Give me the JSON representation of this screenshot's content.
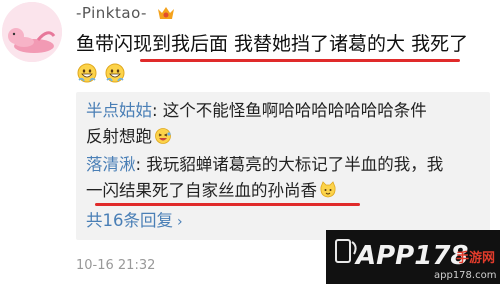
{
  "header": {
    "username": "-Pinktao-"
  },
  "comment": {
    "text": "鱼带闪现到我后面 我替她挡了诸葛的大 我死了"
  },
  "replies": {
    "r1_user": "半点姑姑",
    "r1_text_a": ": 这个不能怪鱼啊哈哈哈哈哈哈哈条件",
    "r1_text_b": "反射想跑",
    "r2_user": "落清湫",
    "r2_text_a": ": 我玩貂蝉诸葛亮的大标记了半血的我，我",
    "r2_text_b": "一闪结果死了自家丝血的孙尚香",
    "more": "共16条回复"
  },
  "meta": {
    "timestamp": "10-16 21:32"
  },
  "watermark": {
    "brand": "APP178",
    "site": "手游网",
    "domain": "app178.com"
  },
  "colors": {
    "link": "#4a7fb6",
    "highlight": "#e02a2a",
    "reply_bg": "#f2f2f2"
  },
  "icons": {
    "vip": "vip-badge-icon",
    "emoji": "grinning-face-icon",
    "reply_emoji": "laughing-face-icon",
    "cat_emoji": "cat-face-icon"
  }
}
